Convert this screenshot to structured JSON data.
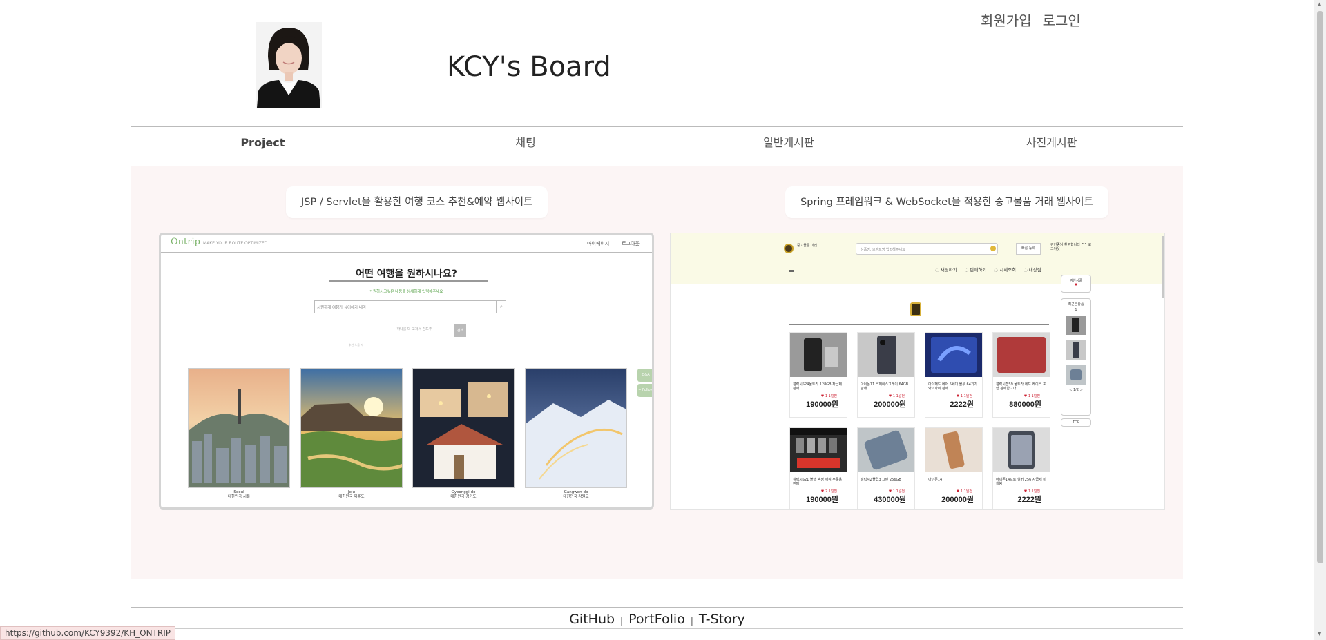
{
  "header": {
    "title": "KCY's Board",
    "auth_links": [
      "회원가입",
      "로그인"
    ]
  },
  "nav": {
    "items": [
      "Project",
      "채팅",
      "일반게시판",
      "사진게시판"
    ],
    "active": "Project"
  },
  "projects": [
    {
      "title": "JSP / Servlet을 활용한 여행 코스 추천&예약 웹사이트",
      "preview": {
        "logo": "Ontrip",
        "logo_tagline": "MAKE YOUR ROUTE OPTIMIZED",
        "menu": [
          "마이페이지",
          "로그아웃"
        ],
        "question": "어떤 여행을 원하시나요?",
        "hint": "* 원하시고싶은 내용을 상세하게 입력해주세요",
        "search_placeholder": "시원하게 여행가 싶어해가 내라",
        "sub_placeholder": "하나를 더 고쳐서 만도추",
        "sub_button": "검색",
        "tiny_text": "추천 노을 자",
        "side_buttons": [
          "Q&A",
          "+ Follow"
        ],
        "cards": [
          {
            "name": "Seoul",
            "sub": "대한민국 서울"
          },
          {
            "name": "Jeju",
            "sub": "대한민국 제주도"
          },
          {
            "name": "Gyeonggi-do",
            "sub": "대한민국 경기도"
          },
          {
            "name": "Gangwon-do",
            "sub": "대한민국 강원도"
          }
        ]
      }
    },
    {
      "title": "Spring 프레임워크 & WebSocket을 적용한 중고물품 거래 웹사이트",
      "preview": {
        "logo_text": "중고물품 마켓",
        "search_placeholder": "상품명, 브랜드명 입력해주세요",
        "search_button": "빠른 등록",
        "user_text": "김현종님 환영합니다 ^^ 로그아웃",
        "nav": [
          "채팅하기",
          "판매하기",
          "시세조회",
          "내상점"
        ],
        "side_title": "찜한상품",
        "side_recent": "최근본상품",
        "side_count": "1",
        "side_pager": "< 1/2 >",
        "side_top": "TOP",
        "items": [
          {
            "name": "갤럭시S24울트라 128GB 자급제 판매",
            "likes": "♥ 1",
            "time": "1일전",
            "price": "190000원"
          },
          {
            "name": "아이폰11 스페이스그레이 64GB 판매",
            "likes": "♥ 1",
            "time": "1일전",
            "price": "200000원"
          },
          {
            "name": "아이패드 에어 5세대 블루 64기가 와이파이 판매",
            "likes": "♥ 1",
            "time": "1일전",
            "price": "2222원"
          },
          {
            "name": "갤럭시탭S9 울트라 레드 케이스 포함 판매합니다",
            "likes": "♥ 1",
            "time": "1일전",
            "price": "880000원"
          },
          {
            "name": "갤럭시S21 블랙 액정 깨짐 부품용 판매",
            "likes": "♥ 2",
            "time": "1일전",
            "price": "190000원"
          },
          {
            "name": "갤럭시Z플립3 그린 256GB",
            "likes": "♥ 1",
            "time": "1일전",
            "price": "430000원"
          },
          {
            "name": "아이폰14",
            "likes": "♥ 1",
            "time": "1일전",
            "price": "200000원"
          },
          {
            "name": "아이폰14프로 실버 256 자급제 미개봉",
            "likes": "♥ 1",
            "time": "1일전",
            "price": "2222원"
          }
        ]
      }
    }
  ],
  "footer": {
    "links": [
      "GitHub",
      "PortFolio",
      "T-Story"
    ],
    "separator": "|"
  },
  "status_bar": {
    "url": "https://github.com/KCY9392/KH_ONTRIP"
  }
}
